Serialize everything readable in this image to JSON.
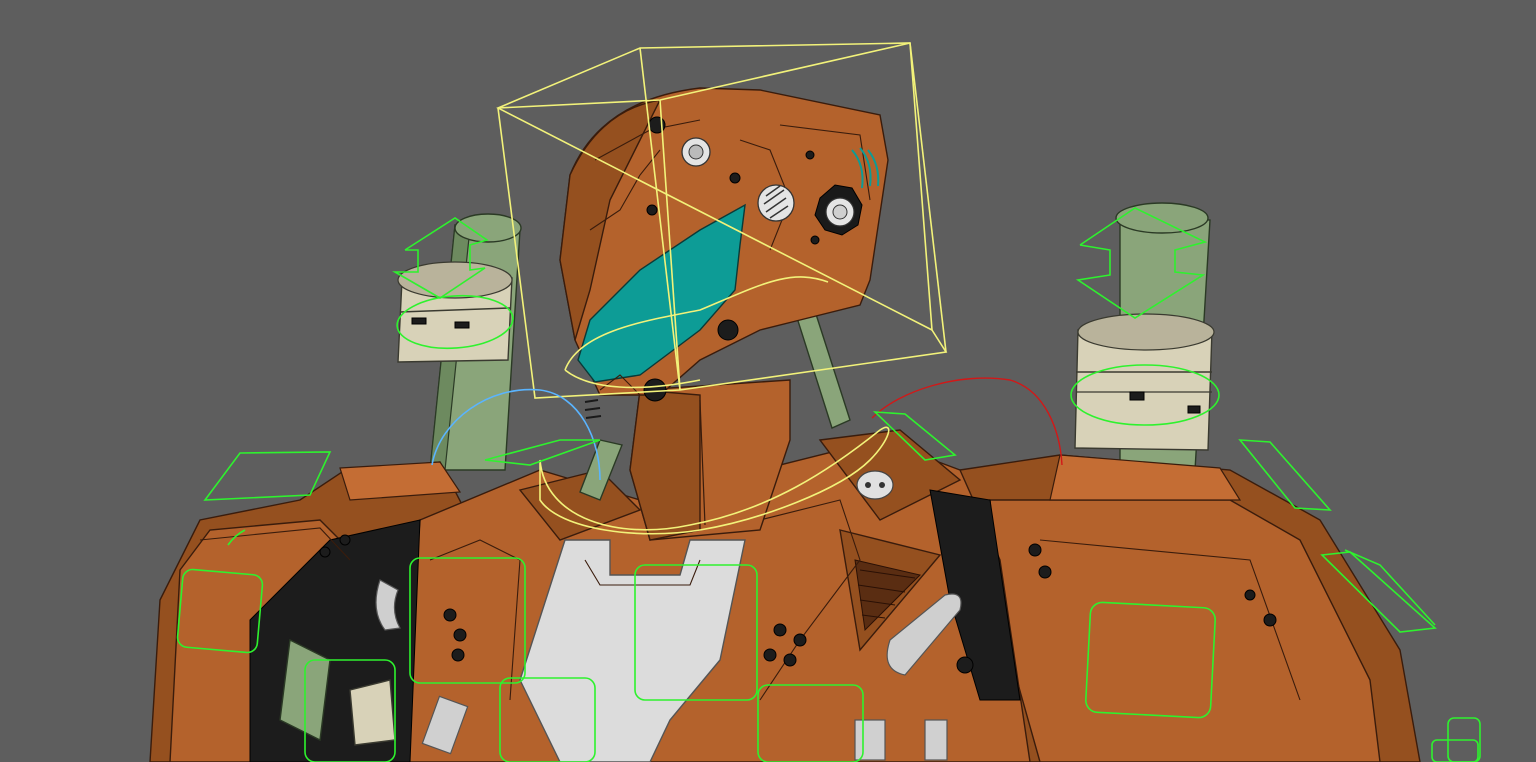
{
  "viewport": {
    "background_color": "#5e5e5e"
  },
  "scene": {
    "subject": "robot-character-rig",
    "colors": {
      "armor": "#b4622c",
      "visor": "#0d9c96",
      "tubes": "#8aa57a",
      "chest_plate": "#dcdcdc",
      "control_green": "#2ef22e",
      "control_yellow": "#f2f27a",
      "control_blue": "#5ab4ff",
      "control_red": "#d21818"
    }
  }
}
